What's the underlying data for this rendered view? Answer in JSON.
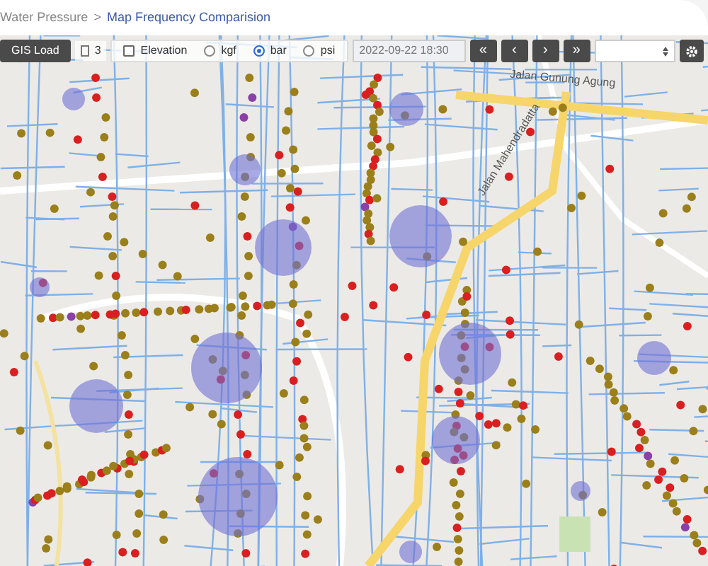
{
  "breadcrumb": {
    "items": [
      "Water Pressure",
      "Map Frequency Comparision"
    ],
    "separator": ">"
  },
  "toolbar": {
    "gis_button": "GIS Load",
    "layer_count": "3",
    "elevation": {
      "label": "Elevation",
      "checked": false
    },
    "units": [
      {
        "label": "kgf",
        "selected": false
      },
      {
        "label": "bar",
        "selected": true
      },
      {
        "label": "psi",
        "selected": false
      }
    ],
    "datetime": "2022-09-22 18:30",
    "nav_buttons": [
      "«",
      "‹",
      "›",
      "»"
    ]
  },
  "map": {
    "street_labels": [
      {
        "text": "Jalan Gunung Agung",
        "kind": "flat"
      },
      {
        "text": "Jalan Mahendradatta",
        "kind": "diagonal"
      }
    ]
  }
}
